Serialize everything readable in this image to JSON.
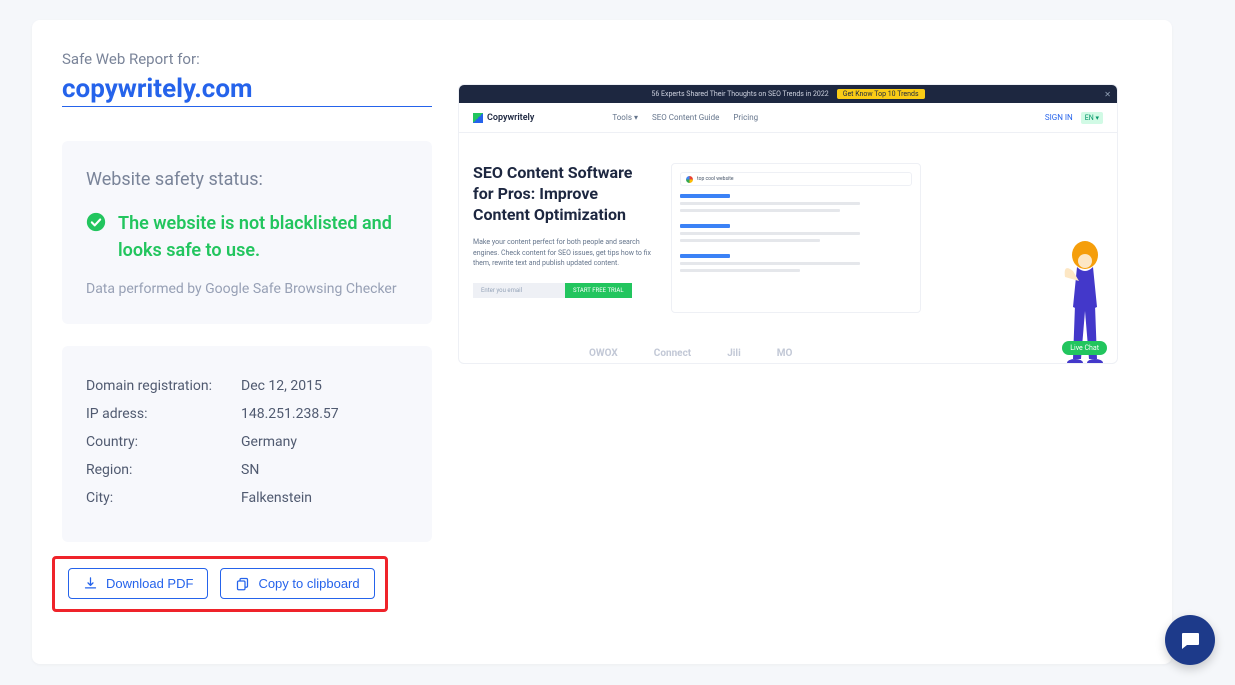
{
  "report": {
    "label": "Safe Web Report for:",
    "domain": "copywritely.com"
  },
  "status": {
    "title": "Website safety status:",
    "message": "The website is not blacklisted and looks safe to use.",
    "sub": "Data performed by Google Safe Browsing Checker"
  },
  "info": {
    "rows": [
      {
        "label": "Domain registration:",
        "value": "Dec 12, 2015"
      },
      {
        "label": "IP adress:",
        "value": "148.251.238.57"
      },
      {
        "label": "Country:",
        "value": "Germany"
      },
      {
        "label": "Region:",
        "value": "SN"
      },
      {
        "label": "City:",
        "value": "Falkenstein"
      }
    ]
  },
  "actions": {
    "download": "Download PDF",
    "copy": "Copy to clipboard"
  },
  "preview": {
    "topbar_text": "56 Experts Shared Their Thoughts on SEO Trends in 2022",
    "topbar_cta": "Get Know Top 10 Trends",
    "logo": "Copywritely",
    "nav": {
      "tools": "Tools",
      "guide": "SEO Content Guide",
      "pricing": "Pricing"
    },
    "signin": "SIGN IN",
    "lang": "EN",
    "headline": "SEO Content Software for Pros: Improve Content Optimization",
    "sub": "Make your content perfect for both people and search engines. Check content for SEO issues, get tips how to fix them, rewrite text and publish updated content.",
    "email_ph": "Enter you email",
    "trial": "START FREE TRIAL",
    "serp_query": "top cool website",
    "logos": {
      "a": "OWOX",
      "b": "Connect",
      "c": "Jili",
      "d": "MO"
    },
    "live_chat": "Live Chat"
  }
}
